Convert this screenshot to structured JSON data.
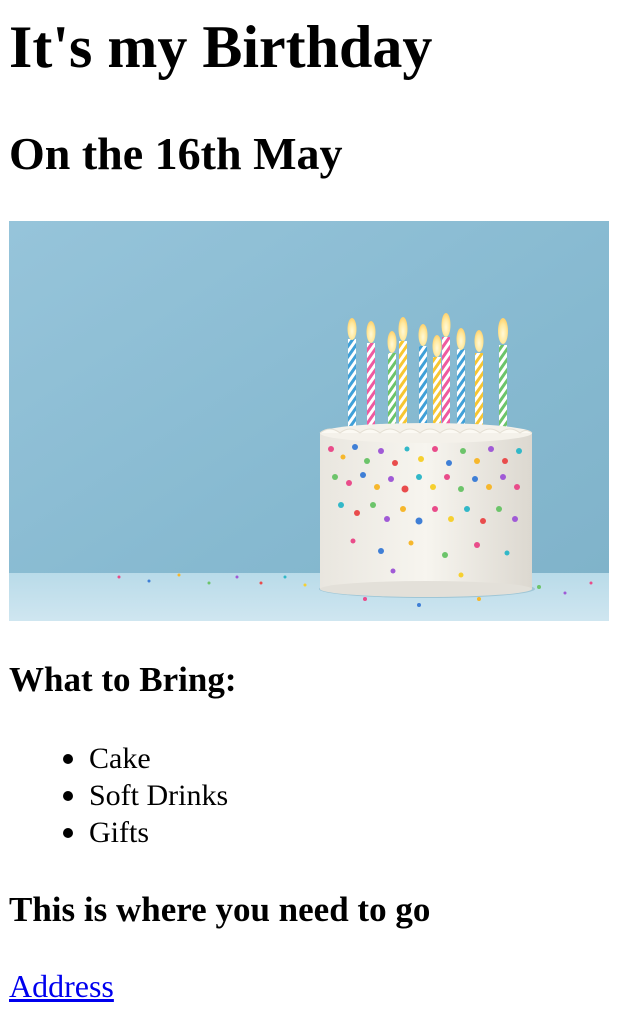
{
  "page": {
    "title": "It's my Birthday",
    "subtitle": "On the 16th May"
  },
  "image": {
    "icon": "birthday-cake-photo"
  },
  "bring": {
    "heading": "What to Bring:",
    "items": [
      "Cake",
      "Soft Drinks",
      "Gifts"
    ]
  },
  "directions": {
    "heading": "This is where you need to go",
    "link_label": "Address"
  },
  "colors": {
    "link": "#0000ee",
    "background_blue": "#8ebfd6"
  }
}
